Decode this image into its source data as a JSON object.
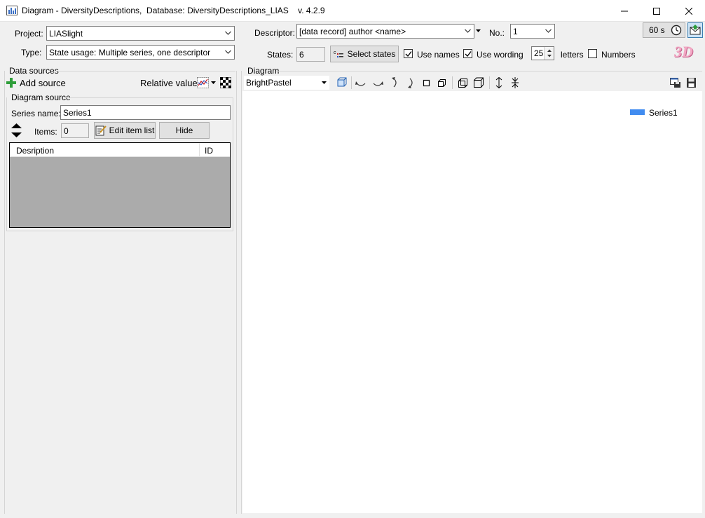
{
  "window": {
    "title": "Diagram - DiversityDescriptions,  Database: DiversityDescriptions_LIAS    v. 4.2.9"
  },
  "top": {
    "project_label": "Project:",
    "project_value": "LIASlight",
    "type_label": "Type:",
    "type_value": "State usage: Multiple series, one descriptor",
    "descriptor_label": "Descriptor:",
    "descriptor_value": "[data record] author <name>",
    "no_label": "No.:",
    "no_value": "1",
    "timer_label": "60 s",
    "states_label": "States:",
    "states_value": "6",
    "select_states_label": "Select states",
    "use_names_label": "Use names",
    "use_names_checked": true,
    "use_wording_label": "Use wording",
    "use_wording_checked": true,
    "letters_value": "25",
    "letters_label": "letters",
    "numbers_label": "Numbers",
    "numbers_checked": false,
    "badge_3d": "3D"
  },
  "sources": {
    "group_label": "Data sources",
    "add_source_label": "Add source",
    "relative_values_label": "Relative values",
    "diagram_source_label": "Diagram source",
    "series_name_label": "Series name:",
    "series_name_value": "Series1",
    "items_label": "Items:",
    "items_value": "0",
    "edit_item_list_label": "Edit item list",
    "hide_label": "Hide",
    "columns": [
      "Desription",
      "ID"
    ]
  },
  "diagram": {
    "group_label": "Diagram",
    "palette_value": "BrightPastel",
    "legend_series": "Series1",
    "series_color": "#418cf0"
  }
}
